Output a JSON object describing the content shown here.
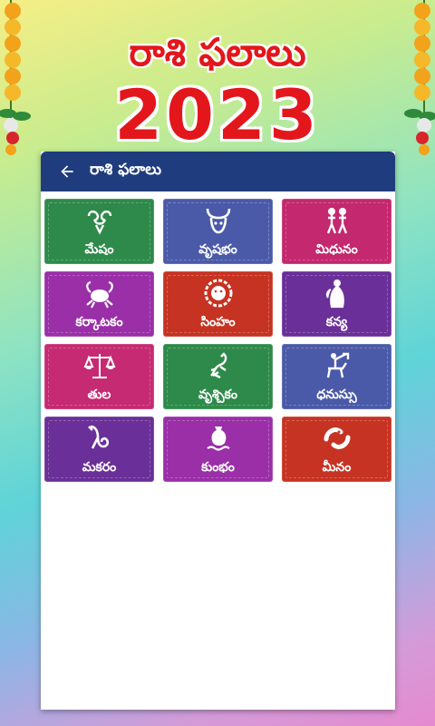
{
  "header": {
    "title": "రాశి ఫలాలు",
    "year": "2023"
  },
  "appbar": {
    "title": "రాశి ఫలాలు",
    "back_icon": "arrow-back-icon"
  },
  "signs": [
    {
      "label": "మేషం",
      "icon": "aries-icon",
      "color": "#2e8a4a"
    },
    {
      "label": "వృషభం",
      "icon": "taurus-icon",
      "color": "#4a5aa8"
    },
    {
      "label": "మిధునం",
      "icon": "gemini-icon",
      "color": "#c4286e"
    },
    {
      "label": "కర్కాటకం",
      "icon": "cancer-icon",
      "color": "#9a2fa8"
    },
    {
      "label": "సింహం",
      "icon": "leo-icon",
      "color": "#c63322"
    },
    {
      "label": "కన్య",
      "icon": "virgo-icon",
      "color": "#6a2f98"
    },
    {
      "label": "తుల",
      "icon": "libra-icon",
      "color": "#c62a72"
    },
    {
      "label": "వృశ్చికం",
      "icon": "scorpio-icon",
      "color": "#2e8a4a"
    },
    {
      "label": "ధనుస్సు",
      "icon": "sagittarius-icon",
      "color": "#4a5aa8"
    },
    {
      "label": "మకరం",
      "icon": "capricorn-icon",
      "color": "#6a2f98"
    },
    {
      "label": "కుంభం",
      "icon": "aquarius-icon",
      "color": "#9a2fa8"
    },
    {
      "label": "మీనం",
      "icon": "pisces-icon",
      "color": "#c63322"
    }
  ]
}
